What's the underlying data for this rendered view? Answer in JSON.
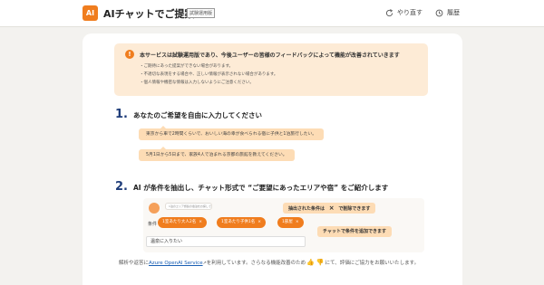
{
  "header": {
    "logo_text": "AI",
    "title": "AIチャットでご提案",
    "badge": "試験運用版",
    "retry_label": "やり直す",
    "history_label": "履歴"
  },
  "notice": {
    "icon": "warning-icon",
    "title": "本サービスは試験運用版であり、今後ユーザーの皆様のフィードバックによって機能が改善されていきます",
    "items": [
      "・ご期待にあった提案ができない場合があります。",
      "・不適切な表現をする場合や、正しい情報が表示されない場合があります。",
      "・個人情報や機密な情報は入力しないようにご注意ください。"
    ]
  },
  "step1": {
    "num": "1.",
    "text": "あなたのご希望を自由に入力してください",
    "examples": [
      "東京から車で2時間くらいで、おいしい海の幸が食べられる宿に子供と1泊旅行したい。",
      "5月1日から5日まで、家族4人で泊まれる京都の旅館を教えてください。"
    ]
  },
  "step2": {
    "num": "2.",
    "text": "AI が条件を抽出し、チャット形式で “ご要望にあったエリアや宿” をご紹介します"
  },
  "mock": {
    "bot_message": "1泊のエリア旅館の宿泊をお探しです。",
    "condition_label": "条件",
    "chips": [
      "1室あたり大人2名",
      "1室あたり子供1名",
      "1部屋"
    ],
    "chip_close": "×",
    "input_value": "温泉に入りたい",
    "callout_delete_prefix": "抽出された条件は",
    "callout_delete_icon": "×",
    "callout_delete_suffix": "で削除できます",
    "callout_add": "チャットで条件を追加できます"
  },
  "footer": {
    "prefix": "解析や返答に",
    "link": "Azure OpenAI Service",
    "middle": "を利用しています。さらなる機能改善のため",
    "suffix": "にて、評価にご協力をお願いいたします。",
    "thumb_up": "👍",
    "thumb_down": "👎"
  }
}
